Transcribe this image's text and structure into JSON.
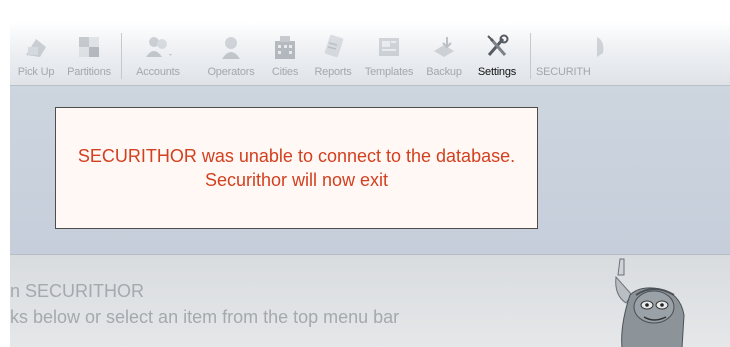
{
  "toolbar": {
    "items": [
      {
        "label": "Pick Up",
        "icon": "pickup-icon"
      },
      {
        "label": "Partitions",
        "icon": "partitions-icon"
      },
      {
        "label": "Accounts",
        "icon": "accounts-icon"
      },
      {
        "label": "Operators",
        "icon": "operators-icon"
      },
      {
        "label": "Cities",
        "icon": "cities-icon"
      },
      {
        "label": "Reports",
        "icon": "reports-icon"
      },
      {
        "label": "Templates",
        "icon": "templates-icon"
      },
      {
        "label": "Backup",
        "icon": "backup-icon"
      },
      {
        "label": "Settings",
        "icon": "settings-icon"
      },
      {
        "label": "SECURITH",
        "icon": "securithor-icon"
      }
    ],
    "active_item": "Settings"
  },
  "dialog": {
    "message": "SECURITHOR was unable to connect to the database. Securithor will now exit"
  },
  "welcome": {
    "title": "n SECURITHOR",
    "subtitle": "ks below or select an item from the top menu bar"
  },
  "colors": {
    "error_text": "#d3401f",
    "toolbar_label_dim": "#a3a8ae",
    "content_bg": "#c8d0dc"
  }
}
